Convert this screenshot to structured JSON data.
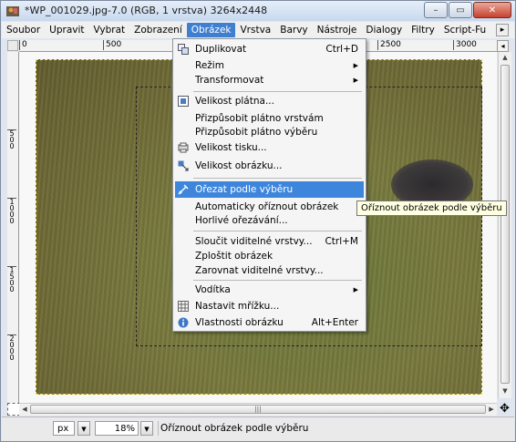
{
  "window": {
    "title": "*WP_001029.jpg-7.0 (RGB, 1 vrstva) 3264x2448",
    "minimize": "–",
    "maximize": "▭",
    "close": "✕"
  },
  "menubar": {
    "items": [
      "Soubor",
      "Upravit",
      "Vybrat",
      "Zobrazení",
      "Obrázek",
      "Vrstva",
      "Barvy",
      "Nástroje",
      "Dialogy",
      "Filtry",
      "Script-Fu"
    ],
    "active_index": 4
  },
  "rulers": {
    "h_labels": [
      "0",
      "500",
      "2500",
      "3000"
    ],
    "v_labels": [
      "5\n0\n0",
      "1\n0\n0\n0",
      "1\n5\n0\n0",
      "2\n0\n0\n0"
    ]
  },
  "menu": {
    "items": [
      {
        "label": "Duplikovat",
        "accel": "Ctrl+D",
        "icon": "duplicate-icon"
      },
      {
        "label": "Režim",
        "submenu": true
      },
      {
        "label": "Transformovat",
        "submenu": true
      },
      {
        "label": "Velikost plátna...",
        "icon": "canvas-size-icon"
      },
      {
        "label": "Přizpůsobit plátno vrstvám"
      },
      {
        "label": "Přizpůsobit plátno výběru"
      },
      {
        "label": "Velikost tisku...",
        "icon": "print-size-icon"
      },
      {
        "label": "Velikost obrázku...",
        "icon": "scale-image-icon"
      },
      {
        "label": "Ořezat podle výběru",
        "icon": "crop-icon",
        "highlighted": true
      },
      {
        "label": "Automaticky oříznout obrázek"
      },
      {
        "label": "Horlivé ořezávání..."
      },
      {
        "label": "Sloučit viditelné vrstvy...",
        "accel": "Ctrl+M"
      },
      {
        "label": "Zploštit obrázek"
      },
      {
        "label": "Zarovnat viditelné vrstvy..."
      },
      {
        "label": "Vodítka",
        "submenu": true
      },
      {
        "label": "Nastavit mřížku...",
        "icon": "grid-icon"
      },
      {
        "label": "Vlastnosti obrázku",
        "accel": "Alt+Enter",
        "icon": "info-icon"
      }
    ]
  },
  "tooltip": "Oříznout obrázek podle výběru",
  "status": {
    "unit": "px",
    "zoom": "18%",
    "message": "Oříznout obrázek podle výběru"
  },
  "colors": {
    "menu_highlight": "#3e86dc",
    "menubar_active": "#3f7fd0"
  }
}
